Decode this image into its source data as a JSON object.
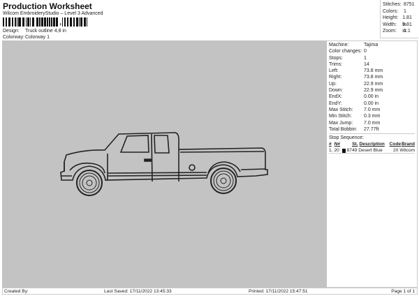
{
  "header": {
    "title": "Production Worksheet",
    "subtitle": "Wilcom EmbroideryStudio – Level 3 Advanced",
    "barcode_suffix": ","
  },
  "design": {
    "design_label": "Design:",
    "design_value": "Truck outline 4,8 in",
    "colorway_label": "Colorway:",
    "colorway_value": "Colorway 1"
  },
  "stats": [
    {
      "k": "Stitches:",
      "v": "8751"
    },
    {
      "k": "Colors:",
      "v": "1"
    },
    {
      "k": "Height:",
      "v": "1.81 in"
    },
    {
      "k": "Width:",
      "v": "5.81 in"
    },
    {
      "k": "Zoom:",
      "v": "1:1"
    }
  ],
  "panel": [
    {
      "k": "Machine:",
      "v": "Tajima"
    },
    {
      "k": "Color changes:",
      "v": "0"
    },
    {
      "k": "Stops:",
      "v": "1"
    },
    {
      "k": "Trims:",
      "v": "14"
    },
    {
      "k": "Left:",
      "v": "73.8 mm"
    },
    {
      "k": "Right:",
      "v": "73.8 mm"
    },
    {
      "k": "Up:",
      "v": "22.9 mm"
    },
    {
      "k": "Down:",
      "v": "22.9 mm"
    },
    {
      "k": "EndX:",
      "v": "0.00 in"
    },
    {
      "k": "EndY:",
      "v": "0.00 in"
    },
    {
      "k": "Max Stitch:",
      "v": "7.0 mm"
    },
    {
      "k": "Min Stitch:",
      "v": "0.3 mm"
    },
    {
      "k": "Max Jump:",
      "v": "7.0 mm"
    },
    {
      "k": "Total Bobbin:",
      "v": "27.77ft"
    }
  ],
  "stop_sequence": {
    "label": "Stop Sequence:",
    "headers": [
      "#",
      "N#",
      "St.",
      "Description",
      "Code",
      "Brand"
    ],
    "rows": [
      {
        "num": "1.",
        "n": "20",
        "color": "#111111",
        "st": "8749",
        "desc": "Desert Blue",
        "code": "20",
        "brand": "Wilcom"
      }
    ]
  },
  "footer": {
    "created": "Created By:",
    "saved": "Last Saved: 17/11/2022 13:45:33",
    "printed": "Printed: 17/11/2022 15:47:51",
    "page": "Page 1 of 1"
  }
}
